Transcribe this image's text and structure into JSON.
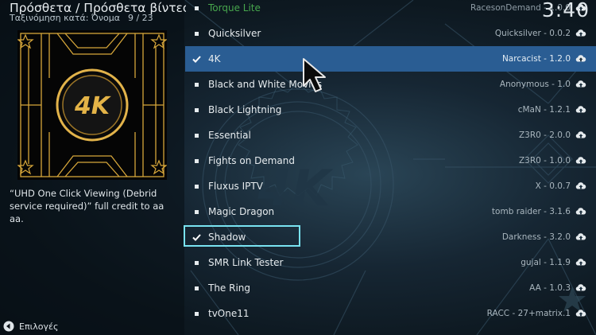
{
  "header": {
    "breadcrumb": "Πρόσθετα / Πρόσθετα βίντεο",
    "sort_label": "Ταξινόμηση κατά: Όνομα",
    "position": "9 / 23",
    "clock": "3:40"
  },
  "info_panel": {
    "thumbnail_text": "4K",
    "description": "“UHD One Click Viewing (Debrid service required)” full credit to aa aa."
  },
  "footer": {
    "options_label": "Επιλογές"
  },
  "addons": [
    {
      "name": "Torque Lite",
      "meta": "RacesonDemand - 1.0.0",
      "mark": "bullet",
      "state": "dim"
    },
    {
      "name": "Quicksilver",
      "meta": "Quicksilver - 0.0.2",
      "mark": "bullet",
      "state": "normal"
    },
    {
      "name": "4K",
      "meta": "Narcacist - 1.2.0",
      "mark": "check",
      "state": "selected"
    },
    {
      "name": "Black and White Movies",
      "meta": "Anonymous - 1.0",
      "mark": "bullet",
      "state": "normal"
    },
    {
      "name": "Black Lightning",
      "meta": "cMaN - 1.2.1",
      "mark": "bullet",
      "state": "normal"
    },
    {
      "name": "Essential",
      "meta": "Z3R0 - 2.0.0",
      "mark": "bullet",
      "state": "normal"
    },
    {
      "name": "Fights on Demand",
      "meta": "Z3R0 - 1.0.0",
      "mark": "bullet",
      "state": "normal"
    },
    {
      "name": "Fluxus IPTV",
      "meta": "X - 0.0.7",
      "mark": "bullet",
      "state": "normal"
    },
    {
      "name": "Magic Dragon",
      "meta": "tomb raider - 3.1.6",
      "mark": "bullet",
      "state": "normal"
    },
    {
      "name": "Shadow",
      "meta": "Darkness - 3.2.0",
      "mark": "check",
      "state": "focused"
    },
    {
      "name": "SMR Link Tester",
      "meta": "gujal - 1.1.9",
      "mark": "bullet",
      "state": "normal"
    },
    {
      "name": "The Ring",
      "meta": "AA - 1.0.3",
      "mark": "bullet",
      "state": "normal"
    },
    {
      "name": "tvOne11",
      "meta": "RACC - 27+matrix.1",
      "mark": "bullet",
      "state": "normal"
    }
  ],
  "colors": {
    "selected_row": "#2a5d93",
    "focus_outline": "#79e3f1",
    "dim_name": "#47a64d",
    "gold": "#d6a63a"
  },
  "icons": {
    "check": "check-icon",
    "bullet": "bullet-icon",
    "cloud": "cloud-upload-icon",
    "options": "back-options-icon",
    "cursor": "mouse-pointer-icon"
  }
}
